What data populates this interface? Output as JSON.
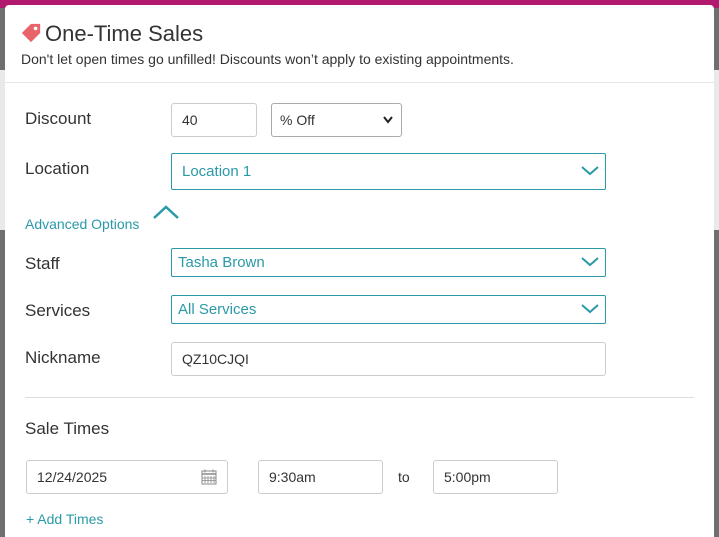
{
  "modal": {
    "title": "One-Time Sales",
    "subtitle": "Don't let open times go unfilled! Discounts won’t apply to existing appointments."
  },
  "form": {
    "discount": {
      "label": "Discount",
      "value": "40",
      "type_selected": "% Off"
    },
    "location": {
      "label": "Location",
      "selected": "Location 1"
    },
    "advanced_options_label": "Advanced Options",
    "staff": {
      "label": "Staff",
      "selected": "Tasha Brown"
    },
    "services": {
      "label": "Services",
      "selected": "All Services"
    },
    "nickname": {
      "label": "Nickname",
      "value": "QZ10CJQI"
    }
  },
  "sale_times": {
    "heading": "Sale Times",
    "date": "12/24/2025",
    "start": "9:30am",
    "to_label": "to",
    "end": "5:00pm",
    "add_times_label": "+ Add Times"
  },
  "colors": {
    "accent": "#2a9aa8",
    "tag_icon": "#e8636a",
    "brand_bar": "#b0196e"
  }
}
